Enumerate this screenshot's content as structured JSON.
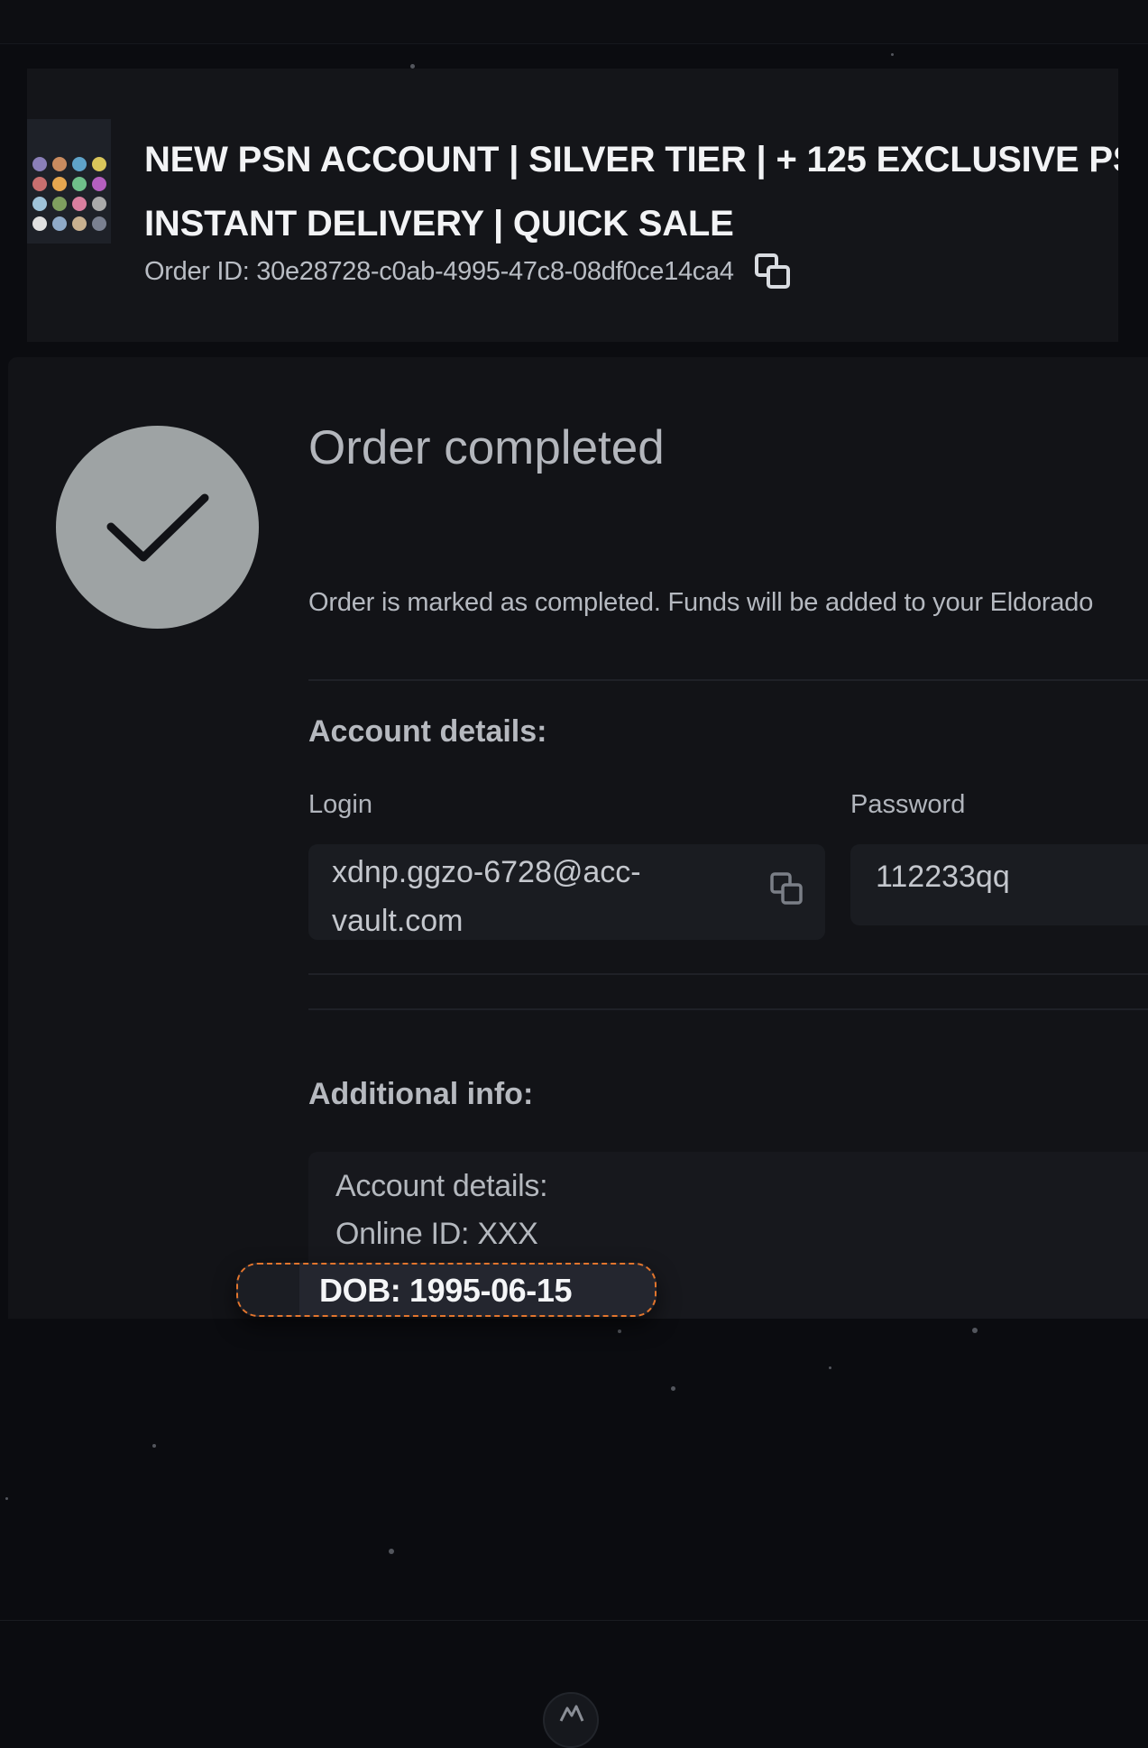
{
  "product": {
    "title_line1": "NEW PSN ACCOUNT | SILVER TIER | + 125 EXCLUSIVE PS",
    "title_line2": "INSTANT DELIVERY | QUICK SALE",
    "order_id_text": "Order ID: 30e28728-c0ab-4995-47c8-08df0ce14ca4",
    "copy_icon": "copy-icon"
  },
  "status": {
    "title": "Order completed",
    "description": "Order is marked as completed. Funds will be added to your Eldorado",
    "check_icon": "checkmark-icon"
  },
  "account_details": {
    "heading": "Account details:",
    "login_label": "Login",
    "login_value": "xdnp.ggzo-6728@acc-vault.com",
    "password_label": "Password",
    "password_value": "112233qq"
  },
  "additional_info": {
    "heading": "Additional info:",
    "lines": [
      "Account details:",
      "Online ID: XXX"
    ],
    "highlighted_line": "DOB: 1995-06-15"
  },
  "colors": {
    "background": "#0b0c10",
    "card": "#141519",
    "check_circle": "#9ea3a4",
    "highlight_border": "#e2752d"
  },
  "footer": {
    "logo_icon": "brand-logo-icon"
  }
}
